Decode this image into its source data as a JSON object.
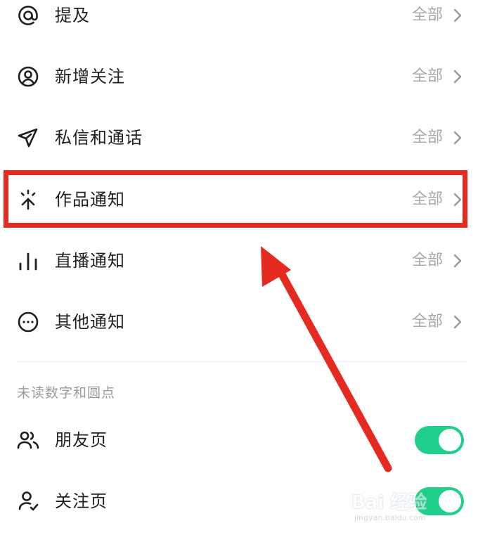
{
  "colors": {
    "accent_toggle": "#1fcf8a",
    "highlight": "#e52a1f",
    "text_primary": "#1f1f1f",
    "text_secondary": "#a8a8ad"
  },
  "notification_rows": [
    {
      "label": "提及",
      "value": "全部",
      "icon": "at-icon"
    },
    {
      "label": "新增关注",
      "value": "全部",
      "icon": "user-circle-icon"
    },
    {
      "label": "私信和通话",
      "value": "全部",
      "icon": "paper-plane-icon"
    },
    {
      "label": "作品通知",
      "value": "全部",
      "icon": "sparkle-icon"
    },
    {
      "label": "直播通知",
      "value": "全部",
      "icon": "bars-icon"
    },
    {
      "label": "其他通知",
      "value": "全部",
      "icon": "more-circle-icon"
    }
  ],
  "unread_section": {
    "header": "未读数字和圆点",
    "items": [
      {
        "label": "朋友页",
        "icon": "friends-icon",
        "enabled": true
      },
      {
        "label": "关注页",
        "icon": "user-check-icon",
        "enabled": true
      }
    ]
  },
  "watermark": {
    "main": "Bai 经验",
    "sub": "jingyan.baidu.com"
  }
}
